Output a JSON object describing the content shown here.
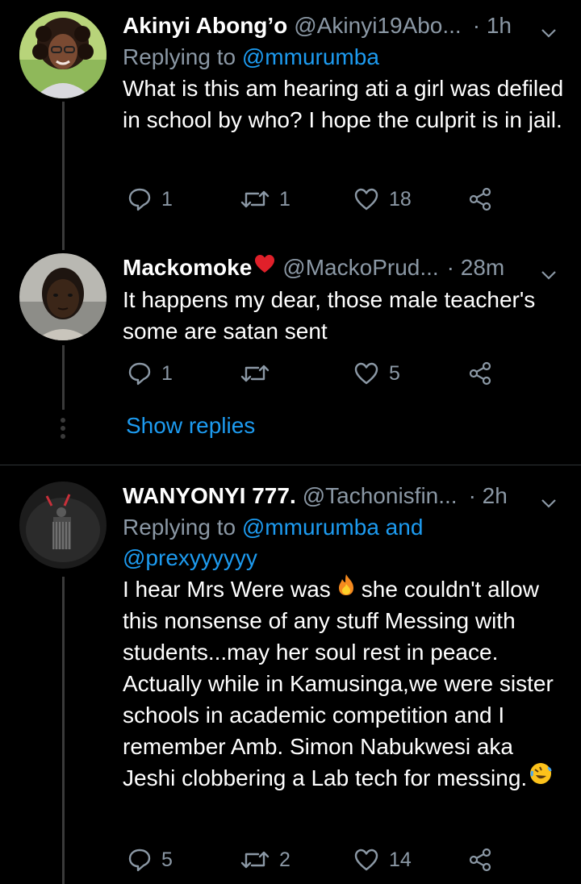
{
  "tweets": [
    {
      "name": "Akinyi Abong’o",
      "handle": "@Akinyi19Abo...",
      "time": "· 1h",
      "replying_prefix": "Replying to ",
      "replying_links": [
        "@mmurumba"
      ],
      "text": "What is this am hearing ati a girl was defiled in school by who? I hope the culprit is in jail.",
      "replies": "1",
      "retweets": "1",
      "likes": "18"
    },
    {
      "name": "Mackomoke",
      "name_emoji": "red-heart",
      "handle": "@MackoPrud...",
      "time": "· 28m",
      "text": "It happens my dear, those male teacher's some are satan sent",
      "replies": "1",
      "retweets": "",
      "likes": "5"
    },
    {
      "name": "WANYONYI 777.",
      "handle": "@Tachonisfin...",
      "time": "· 2h",
      "replying_prefix": "Replying to ",
      "replying_links": [
        "@mmurumba",
        "@prexyyyyyy"
      ],
      "replying_and": " and",
      "text_part1": "I hear Mrs Were was",
      "text_part2": "she couldn't allow this nonsense of any stuff Messing with students...may her soul rest in peace. Actually while in Kamusinga,we were sister schools in academic competition and I remember Amb. Simon Nabukwesi aka Jeshi clobbering a Lab tech for messing.",
      "replies": "5",
      "retweets": "2",
      "likes": "14"
    }
  ],
  "show_replies": "Show replies",
  "colors": {
    "background": "#000000",
    "secondary": "#8b98a5",
    "link": "#1d9bf0",
    "thread": "#3a3a3a"
  },
  "icons": [
    "reply-icon",
    "retweet-icon",
    "like-icon",
    "share-icon",
    "caret-down-icon",
    "fire-emoji",
    "rolling-laughing-emoji",
    "red-heart-emoji"
  ]
}
